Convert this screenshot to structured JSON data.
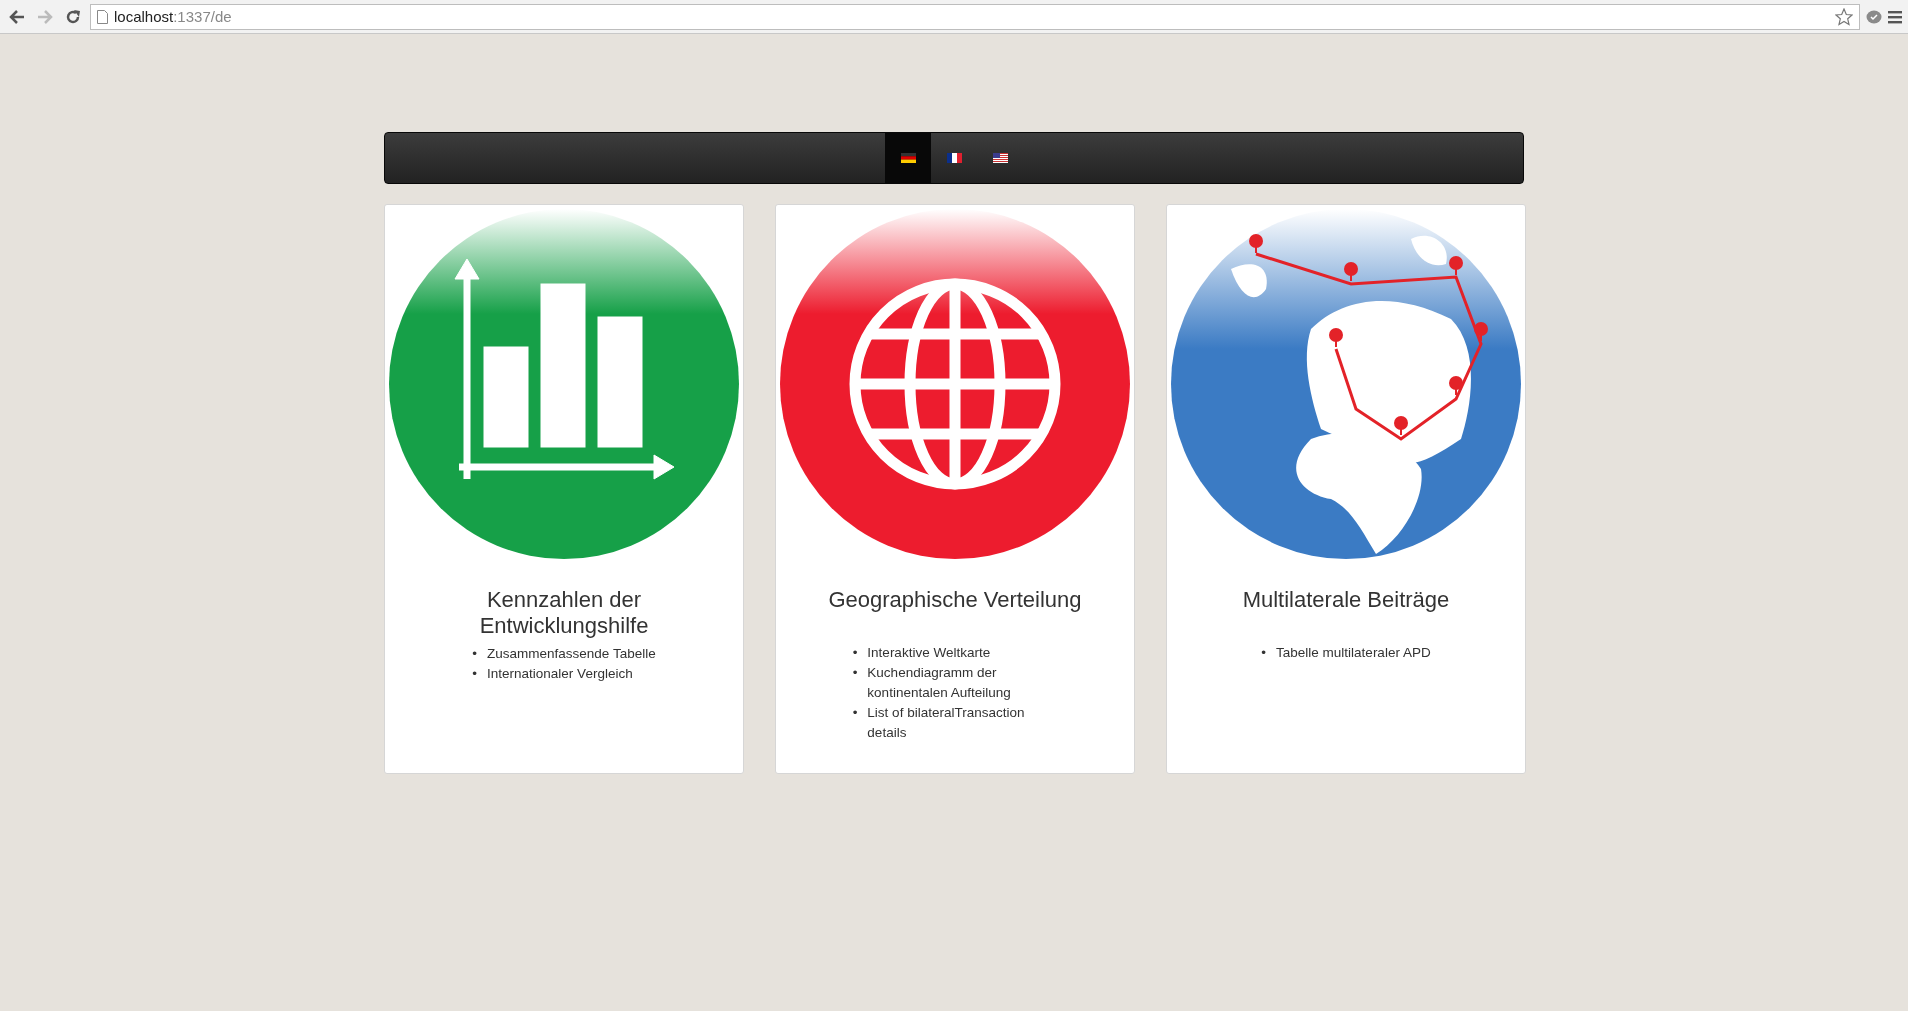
{
  "browser": {
    "url_host": "localhost",
    "url_path": ":1337/de",
    "forward_disabled": true
  },
  "navbar": {
    "languages": [
      {
        "kind": "de",
        "selected": true
      },
      {
        "kind": "fr",
        "selected": false
      },
      {
        "kind": "us",
        "selected": false
      }
    ]
  },
  "bullet": "•",
  "cards": [
    {
      "kind": "chart",
      "title": "Kennzahlen der Entwicklungshilfe",
      "items": [
        "Zusammenfassende Tabelle",
        "Internationaler Vergleich"
      ]
    },
    {
      "kind": "globe",
      "title": "Geographische Verteilung",
      "items": [
        "Interaktive Weltkarte",
        "Kuchendiagramm der kontinentalen Aufteilung",
        "List of bilateralTransaction details"
      ]
    },
    {
      "kind": "map",
      "title": "Multilaterale Beiträge",
      "items": [
        "Tabelle multilateraler APD"
      ]
    }
  ]
}
